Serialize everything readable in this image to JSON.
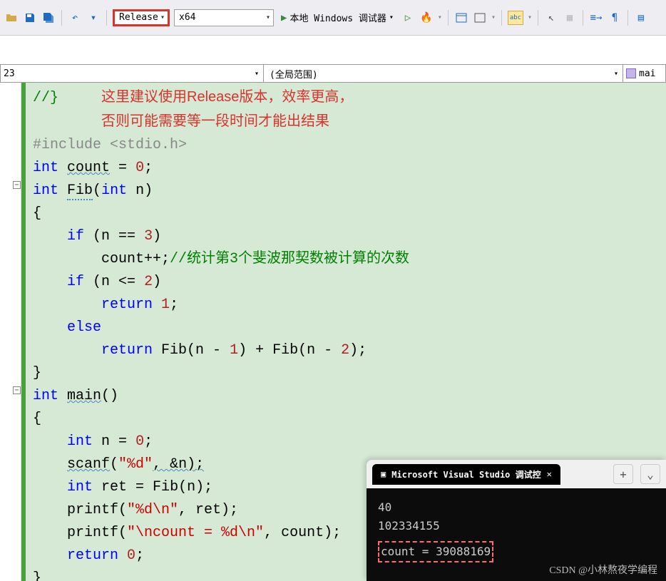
{
  "toolbar": {
    "config": "Release",
    "platform": "x64",
    "debug_label": "本地 Windows 调试器"
  },
  "nav": {
    "left": "23",
    "scope": "(全局范围)",
    "right": "mai"
  },
  "annotation": {
    "line1": "这里建议使用Release版本，效率更高，",
    "line2": "否则可能需要等一段时间才能出结果"
  },
  "code": {
    "top_comment": "//}",
    "include": "#include <stdio.h>",
    "count_decl_kw": "int",
    "count_decl_name": "count",
    "count_decl_eq": " = ",
    "count_decl_val": "0",
    "fib_sig_kw": "int",
    "fib_sig_name": "Fib",
    "fib_sig_param_kw": "int",
    "fib_sig_param": "n",
    "if1_kw": "if",
    "if1_cond": "(n == ",
    "if1_val": "3",
    "count_inc": "count++;",
    "count_comment": "//统计第3个斐波那契数被计算的次数",
    "if2_kw": "if",
    "if2_cond": "(n <= ",
    "if2_val": "2",
    "ret1_kw": "return",
    "ret1_val": "1",
    "else_kw": "else",
    "ret2_kw": "return",
    "ret2_expr1": "Fib(n - ",
    "ret2_v1": "1",
    "ret2_mid": ") + Fib(n - ",
    "ret2_v2": "2",
    "main_kw": "int",
    "main_name": "main",
    "n_decl_kw": "int",
    "n_decl": "n = ",
    "n_val": "0",
    "scanf_name": "scanf",
    "scanf_fmt": "\"%d\"",
    "scanf_arg": ", &n);",
    "ret_decl_kw": "int",
    "ret_decl": "ret = Fib(n);",
    "printf1": "printf(",
    "printf1_fmt": "\"%d\\n\"",
    "printf1_arg": ", ret);",
    "printf2": "printf(",
    "printf2_fmt": "\"\\ncount = %d\\n\"",
    "printf2_arg": ", count);",
    "ret3_kw": "return",
    "ret3_val": "0"
  },
  "console": {
    "title": "Microsoft Visual Studio 调试控",
    "input": "40",
    "output1": "102334155",
    "output2": "count = 39088169"
  },
  "watermark": "CSDN @小林熬夜学编程"
}
